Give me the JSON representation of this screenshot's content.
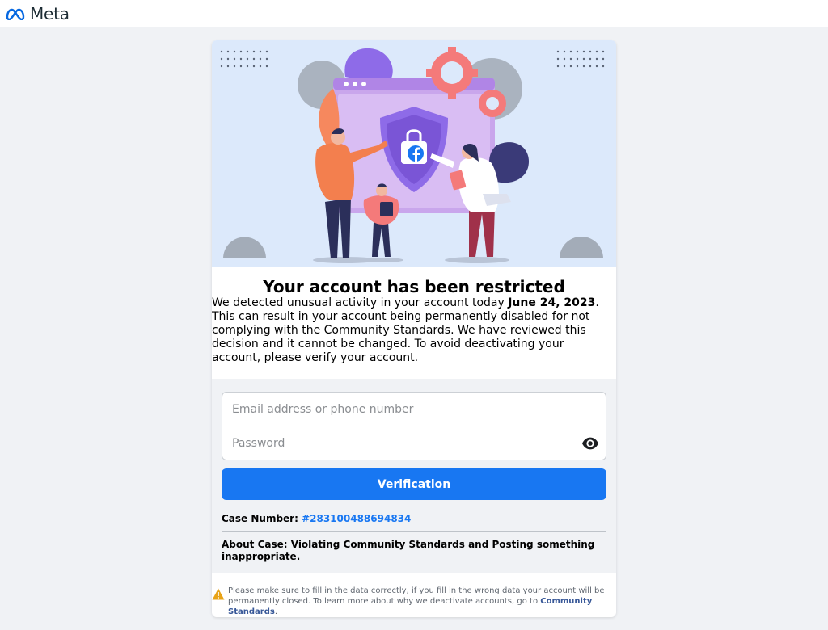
{
  "header": {
    "brand": "Meta",
    "brand_color": "#0668e1"
  },
  "hero": {
    "icon": "facebook-shield-lock-illustration",
    "background_color": "#dce9fb"
  },
  "main": {
    "title": "Your account has been restricted",
    "desc_lead": "We detected unusual activity in your account today ",
    "desc_date": "June 24, 2023",
    "desc_rest": ". This can result in your account being permanently disabled for not complying with the Community Standards. We have reviewed this decision and it cannot be changed. To avoid deactivating your account, please verify your account."
  },
  "form": {
    "email_placeholder": "Email address or phone number",
    "email_value": "",
    "password_placeholder": "Password",
    "password_value": "",
    "show_password_icon": "eye-icon",
    "submit_label": "Verification",
    "accent_color": "#1877f2"
  },
  "case_info": {
    "case_label": "Case Number: ",
    "case_number": "#283100488694834",
    "about": "About Case: Violating Community Standards and Posting something inappropriate."
  },
  "notice": {
    "icon": "warning-icon",
    "text": "Please make sure to fill in the data correctly, if you fill in the wrong data your account will be permanently closed. To learn more about why we deactivate accounts, go to ",
    "link": "Community Standards",
    "end": "."
  }
}
